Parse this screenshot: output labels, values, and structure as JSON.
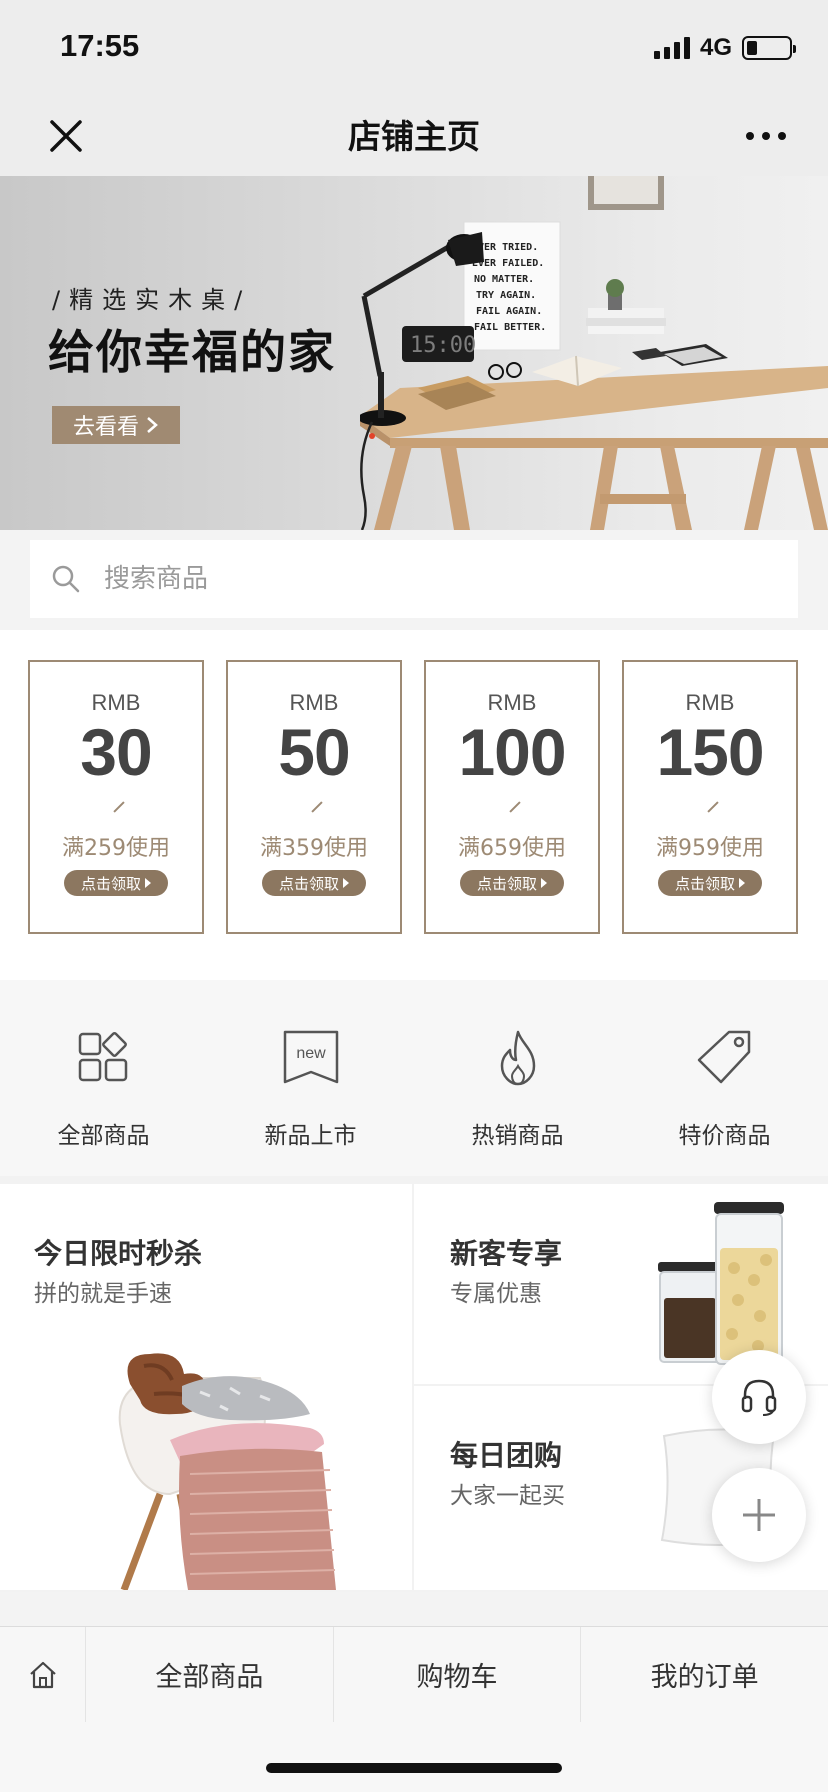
{
  "status_bar": {
    "time": "17:55",
    "network": "4G",
    "battery_level": 0.25
  },
  "nav": {
    "title": "店铺主页",
    "close_icon": "close-icon",
    "more_icon": "more-icon"
  },
  "banner": {
    "subtitle": "/精选实木桌/",
    "title": "给你幸福的家",
    "button_label": "去看看",
    "poster_lines": [
      "EVER TRIED.",
      "EVER FAILED.",
      "NO MATTER.",
      "TRY AGAIN.",
      "FAIL AGAIN.",
      "FAIL BETTER."
    ],
    "clock_text": "15:00"
  },
  "search": {
    "placeholder": "搜索商品"
  },
  "coupons": [
    {
      "currency": "RMB",
      "amount": "30",
      "condition": "满259使用",
      "button": "点击领取"
    },
    {
      "currency": "RMB",
      "amount": "50",
      "condition": "满359使用",
      "button": "点击领取"
    },
    {
      "currency": "RMB",
      "amount": "100",
      "condition": "满659使用",
      "button": "点击领取"
    },
    {
      "currency": "RMB",
      "amount": "150",
      "condition": "满959使用",
      "button": "点击领取"
    }
  ],
  "categories": [
    {
      "label": "全部商品",
      "icon": "all-products-icon"
    },
    {
      "label": "新品上市",
      "icon": "new-icon",
      "icon_text": "new"
    },
    {
      "label": "热销商品",
      "icon": "flame-icon"
    },
    {
      "label": "特价商品",
      "icon": "price-tag-icon"
    }
  ],
  "promos": {
    "flash_sale": {
      "title": "今日限时秒杀",
      "subtitle": "拼的就是手速"
    },
    "new_customer": {
      "title": "新客专享",
      "subtitle": "专属优惠"
    },
    "group_buy": {
      "title": "每日团购",
      "subtitle": "大家一起买"
    }
  },
  "tab_bar": {
    "items": [
      "全部商品",
      "购物车",
      "我的订单"
    ],
    "home_icon": "home-icon"
  },
  "colors": {
    "accent": "#9d8a74",
    "button": "#a08a72",
    "text": "#333333"
  }
}
